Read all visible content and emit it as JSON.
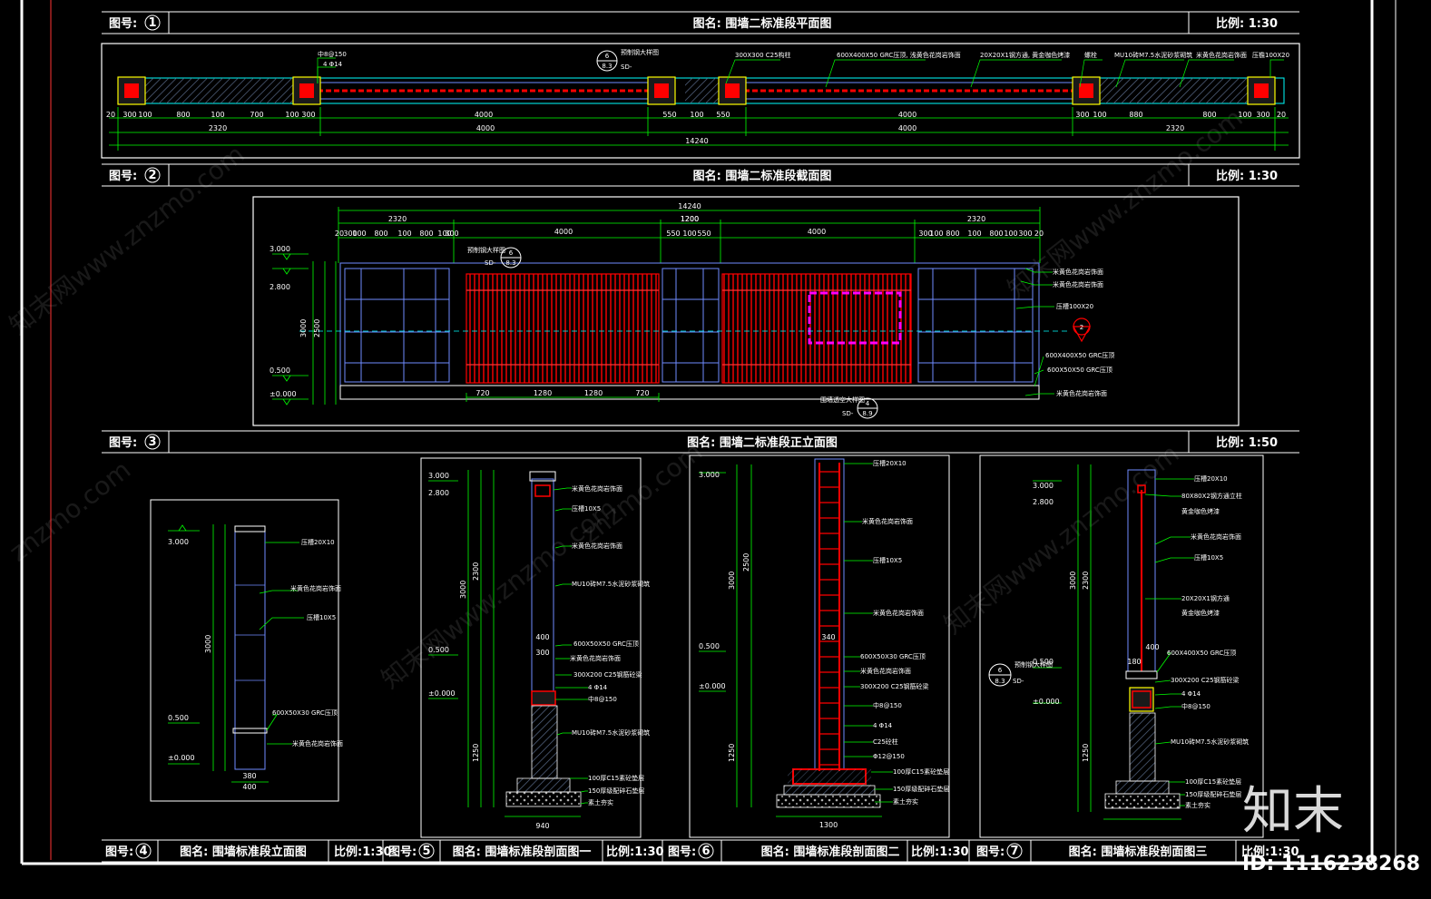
{
  "sheet": {
    "views": [
      {
        "no_label": "图号:",
        "no": "1",
        "title": "图名: 围墙二标准段平面图",
        "scale": "比例: 1:30"
      },
      {
        "no_label": "图号:",
        "no": "2",
        "title": "图名: 围墙二标准段截面图",
        "scale": "比例: 1:30"
      },
      {
        "no_label": "图号:",
        "no": "3",
        "title": "图名: 围墙二标准段正立面图",
        "scale": "比例: 1:50"
      },
      {
        "no_label": "图号:",
        "no": "4",
        "title": "图名: 围墙标准段立面图",
        "scale": "比例:1:30"
      },
      {
        "no_label": "图号:",
        "no": "5",
        "title": "图名: 围墙标准段剖面图一",
        "scale": "比例:1:30"
      },
      {
        "no_label": "图号:",
        "no": "6",
        "title": "图名: 围墙标准段剖面图二",
        "scale": "比例:1:30"
      },
      {
        "no_label": "图号:",
        "no": "7",
        "title": "图名: 围墙标准段剖面图三",
        "scale": "比例:1:30"
      }
    ]
  },
  "plan": {
    "dims_row1": [
      "20",
      "300",
      "100",
      "800",
      "100",
      "700",
      "100",
      "300",
      "4000",
      "550",
      "100",
      "550",
      "4000",
      "300",
      "100",
      "880",
      "800",
      "100",
      "300",
      "20"
    ],
    "dims_row2": [
      "2320",
      "4000",
      "4000",
      "2320"
    ],
    "total": "14240",
    "notes": [
      "中8@150",
      "4 Φ14",
      "300X300 C25构柱",
      "600X400X50 GRC压顶, 浅黄色花岗岩饰面",
      "20X20X1钢方通, 黄金咖色烤漆",
      "螺栓",
      "MU10砖M7.5水泥砂浆砌筑",
      "米黄色花岗岩饰面",
      "压檐100X20"
    ],
    "callout": {
      "top": "6",
      "bottom": "8.3",
      "prefix": "SD-"
    },
    "callout_label": "预制钢大样图"
  },
  "elevation": {
    "total": "14240",
    "dims_row": [
      "2320",
      "1200",
      "4000",
      "1200",
      "4000",
      "2320"
    ],
    "dims_fine": [
      "20",
      "300",
      "100",
      "800",
      "100",
      "800",
      "100",
      "300",
      "4000",
      "550",
      "100",
      "550",
      "4000",
      "300",
      "100",
      "800",
      "100",
      "800",
      "100",
      "300",
      "20"
    ],
    "levels": [
      "3.000",
      "2.800",
      "0.500",
      "±0.000"
    ],
    "bottom_dims": [
      "720",
      "1280",
      "1280",
      "720"
    ],
    "vert_dims": [
      "200",
      "10",
      "580",
      "10",
      "580",
      "10",
      "580",
      "10",
      "450",
      "500",
      "3000",
      "2500"
    ],
    "notes": [
      "米黄色花岗岩饰面",
      "米黄色花岗岩饰面",
      "压槽100X20",
      "600X400X50 GRC压顶",
      "600X50X50 GRC压顶",
      "米黄色花岗岩饰面"
    ],
    "callout_top": {
      "top": "6",
      "bottom": "8.3",
      "prefix": "SD-",
      "label": "预制钢大样图"
    },
    "callout_bottom": {
      "top": "4",
      "bottom": "8.9",
      "prefix": "SD-",
      "label": "围墙透空大样图"
    },
    "section_mark": "2"
  },
  "section4": {
    "levels": [
      "3.000",
      "0.500",
      "±0.000"
    ],
    "notes": [
      "压槽20X10",
      "米黄色花岗岩饰面",
      "压槽10X5",
      "600X50X30 GRC压顶",
      "米黄色花岗岩饰面"
    ],
    "bottom_dims": [
      "400",
      "380"
    ],
    "vert_dims": [
      "3000",
      "580",
      "580",
      "580",
      "580",
      "450"
    ]
  },
  "section5": {
    "levels": [
      "3.000",
      "2.800",
      "0.500",
      "±0.000"
    ],
    "notes": [
      "米黄色花岗岩饰面",
      "压槽10X5",
      "米黄色花岗岩饰面",
      "MU10砖M7.5水泥砂浆砌筑",
      "600X50X50 GRC压顶",
      "米黄色花岗岩饰面",
      "300X200 C25钢筋砼梁",
      "4 Φ14",
      "中8@150",
      "MU10砖M7.5水泥砂浆砌筑",
      "100厚C15素砼垫层",
      "150厚级配碎石垫层",
      "素土夯实"
    ],
    "bottom_dims": [
      "400",
      "300",
      "940"
    ],
    "vert_dims": [
      "200",
      "10",
      "580",
      "10",
      "580",
      "2300",
      "3000",
      "10",
      "580",
      "10",
      "380",
      "500",
      "450",
      "760",
      "1250",
      "100",
      "150"
    ]
  },
  "section6": {
    "levels": [
      "3.000",
      "0.500",
      "±0.000"
    ],
    "notes": [
      "压槽20X10",
      "米黄色花岗岩饰面",
      "压槽10X5",
      "米黄色花岗岩饰面",
      "600X50X30 GRC压顶",
      "米黄色花岗岩饰面",
      "300X200 C25钢筋砼梁",
      "中8@150",
      "4 Φ14",
      "C25砼柱",
      "Φ12@150",
      "100厚C15素砼垫层",
      "150厚级配碎石垫层",
      "素土夯实"
    ],
    "bottom_dims": [
      "100",
      "300",
      "300",
      "300",
      "300",
      "100",
      "1300",
      "300",
      "340"
    ],
    "vert_dims": [
      "3000",
      "2500",
      "500",
      "1250",
      "200",
      "100",
      "150"
    ]
  },
  "section7": {
    "levels": [
      "3.000",
      "2.800",
      "0.500",
      "±0.000"
    ],
    "notes": [
      "压槽20X10",
      "80X80X2钢方通立柱",
      "黄金咖色烤漆",
      "米黄色花岗岩饰面",
      "压槽10X5",
      "20X20X1钢方通",
      "黄金咖色烤漆",
      "600X400X50 GRC压顶",
      "300X200 C25钢筋砼梁",
      "4 Φ14",
      "中8@150",
      "MU10砖M7.5水泥砂浆砌筑",
      "100厚C15素砼垫层",
      "150厚级配碎石垫层",
      "素土夯实"
    ],
    "bottom_dims": [
      "180",
      "20",
      "400"
    ],
    "vert_dims": [
      "3000",
      "2300",
      "500",
      "1250",
      "200",
      "100",
      "150"
    ],
    "callout": {
      "top": "6",
      "bottom": "8.3",
      "prefix": "SD-",
      "label": "预制钢大样图"
    }
  },
  "watermark": {
    "site": "知末网www.znzmo.com",
    "short": "znzmo.com"
  },
  "branding": {
    "logo": "知末",
    "id": "ID: 1116238268"
  },
  "colors": {
    "background": "#000000",
    "frame": "#ffffff",
    "green": "#00ff00",
    "red": "#ff0000",
    "cyan": "#00ffff",
    "magenta": "#ff00ff",
    "yellow": "#ffff00",
    "blue": "#6f8cff"
  }
}
